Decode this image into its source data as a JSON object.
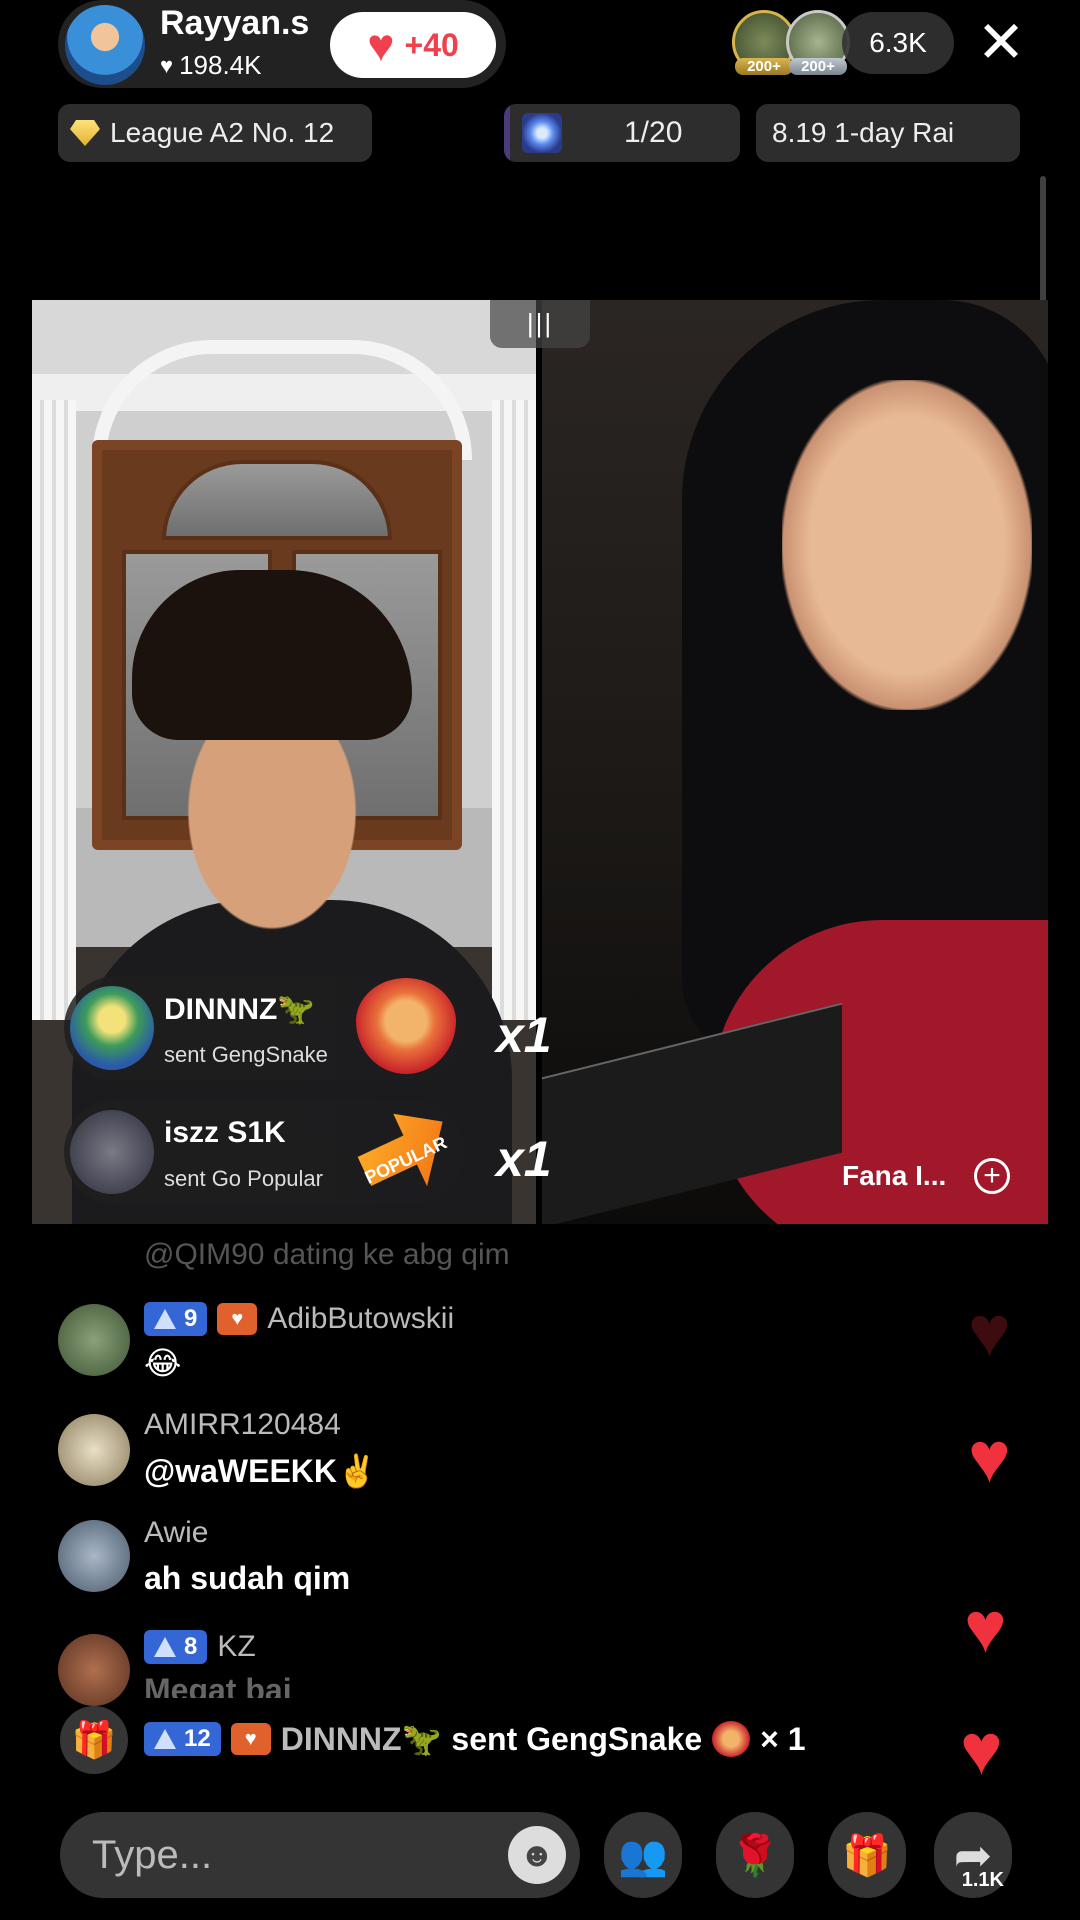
{
  "host": {
    "name": "Rayyan.s",
    "likes": "198.4K",
    "follow_label": "+40"
  },
  "viewers": {
    "badge1": "200+",
    "badge2": "200+",
    "count": "6.3K"
  },
  "badges": {
    "league": "League A2 No. 12",
    "rank": "1/20",
    "daily": "8.19 1-day Rai"
  },
  "video": {
    "guest_name": "Fana I..."
  },
  "gifts": [
    {
      "user": "DINNNZ🦖",
      "action": "sent GengSnake",
      "count": "x1"
    },
    {
      "user": "iszz S1K",
      "action": "sent Go Popular",
      "count": "x1"
    }
  ],
  "gift_sticker_text": "POPULAR",
  "comments": {
    "partial_top": "@QIM90 dating ke abg qim",
    "items": [
      {
        "level": "9",
        "fan": true,
        "name": "AdibButowskii",
        "text": "😂"
      },
      {
        "name": "AMIRR120484",
        "text": "@waWEEKK✌️"
      },
      {
        "name": "Awie",
        "text": "ah sudah qim"
      },
      {
        "level": "8",
        "name": "KZ",
        "text": "Megat bai"
      }
    ]
  },
  "ticker": {
    "level": "12",
    "user": "DINNNZ🦖",
    "text": "sent GengSnake",
    "count": "× 1"
  },
  "bottom": {
    "placeholder": "Type...",
    "share_count": "1.1K"
  },
  "colors": {
    "accent_red": "#f0323e",
    "level_blue": "#3466d6"
  },
  "icons": [
    "heart-icon",
    "close-icon",
    "diamond-icon",
    "gift-box-icon",
    "emoji-icon",
    "multi-guest-icon",
    "rose-icon",
    "gift-icon",
    "share-icon"
  ]
}
